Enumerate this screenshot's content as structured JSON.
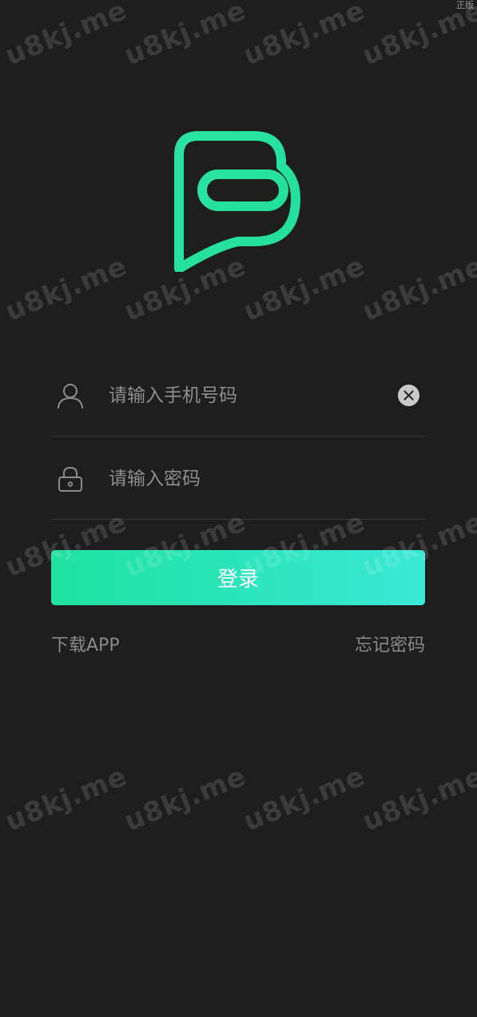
{
  "version_label": "正版",
  "form": {
    "phone_placeholder": "请输入手机号码",
    "password_placeholder": "请输入密码",
    "login_label": "登录"
  },
  "links": {
    "download": "下载APP",
    "forgot_password": "忘记密码"
  },
  "watermark": {
    "text": "u8kj.me"
  },
  "colors": {
    "background": "#1e1e1e",
    "accent_start": "#1fe1a0",
    "accent_end": "#3ae8d6",
    "logo": "#22df9b"
  },
  "icons": {
    "logo": "chat-bubble-logo",
    "phone_field": "user-icon",
    "password_field": "lock-icon",
    "clear": "clear-icon"
  }
}
